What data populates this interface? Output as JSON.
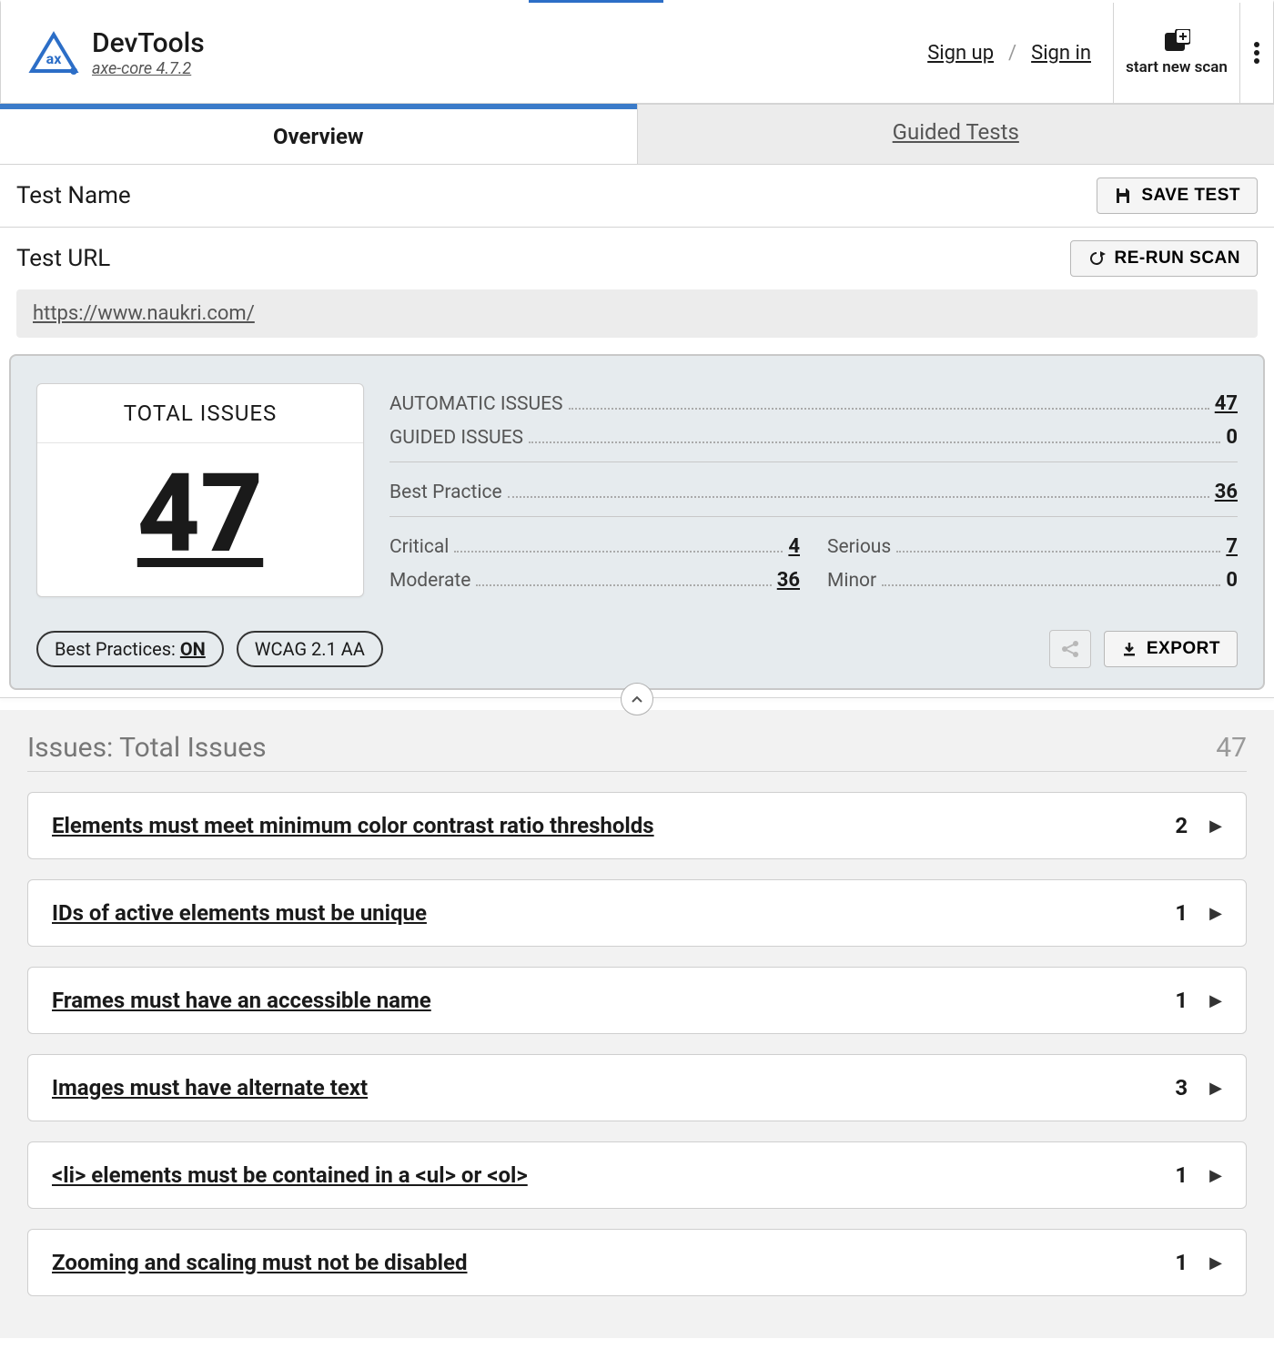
{
  "header": {
    "brand_title": "DevTools",
    "brand_sub": "axe-core 4.7.2",
    "signup": "Sign up",
    "signin": "Sign in",
    "sep": "/",
    "new_scan": "start new scan"
  },
  "tabs": {
    "overview": "Overview",
    "guided": "Guided Tests"
  },
  "fields": {
    "test_name_label": "Test Name",
    "save_test": "SAVE TEST",
    "test_url_label": "Test URL",
    "rerun": "RE-RUN SCAN",
    "url": "https://www.naukri.com/"
  },
  "summary": {
    "total_label": "TOTAL ISSUES",
    "total_value": "47",
    "rows": {
      "automatic_label": "AUTOMATIC ISSUES",
      "automatic_value": "47",
      "guided_label": "GUIDED ISSUES",
      "guided_value": "0",
      "bp_label": "Best Practice",
      "bp_value": "36",
      "critical_label": "Critical",
      "critical_value": "4",
      "serious_label": "Serious",
      "serious_value": "7",
      "moderate_label": "Moderate",
      "moderate_value": "36",
      "minor_label": "Minor",
      "minor_value": "0"
    },
    "pill_bp_label": "Best Practices: ",
    "pill_bp_state": "ON",
    "pill_wcag": "WCAG 2.1 AA",
    "export": "EXPORT"
  },
  "issues": {
    "title": "Issues: Total Issues",
    "count": "47",
    "items": [
      {
        "label": "Elements must meet minimum color contrast ratio thresholds",
        "count": "2"
      },
      {
        "label": "IDs of active elements must be unique",
        "count": "1"
      },
      {
        "label": "Frames must have an accessible name",
        "count": "1"
      },
      {
        "label": "Images must have alternate text",
        "count": "3"
      },
      {
        "label": "<li> elements must be contained in a <ul> or <ol>",
        "count": "1"
      },
      {
        "label": "Zooming and scaling must not be disabled",
        "count": "1"
      }
    ]
  }
}
